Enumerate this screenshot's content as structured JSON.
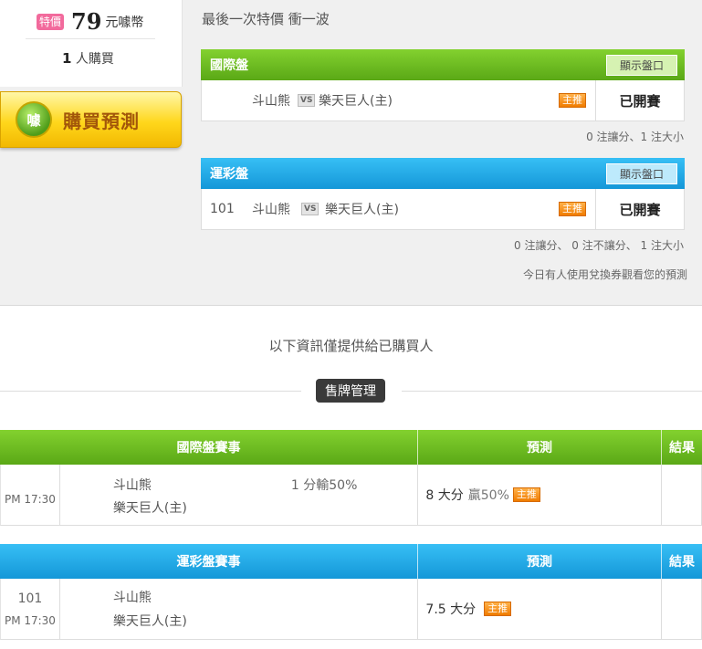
{
  "price": {
    "badge": "特價",
    "amount": "79",
    "unit": "元噱幣",
    "buyer_count": "1",
    "buyer_suffix": "人購買"
  },
  "buy_button": {
    "icon_text": "噱",
    "label": "購買預測"
  },
  "headline": "最後一次特價 衝一波",
  "cards": [
    {
      "title": "國際盤",
      "show_label": "顯示盤口",
      "match_no": "",
      "away": "斗山熊",
      "vs": "VS",
      "home": "樂天巨人(主)",
      "rec_badge": "主推",
      "status": "已開賽",
      "note": "0 注讓分、1 注大小"
    },
    {
      "title": "運彩盤",
      "show_label": "顯示盤口",
      "match_no": "101",
      "away": "斗山熊",
      "vs": "VS",
      "home": "樂天巨人(主)",
      "rec_badge": "主推",
      "status": "已開賽",
      "note": "0 注讓分、 0 注不讓分、 1 注大小"
    }
  ],
  "coupon_note": "今日有人使用兌換券觀看您的預測",
  "info_line": "以下資訊僅提供給已購買人",
  "sell_button": "售牌管理",
  "tables": [
    {
      "headers": {
        "match": "國際盤賽事",
        "prediction": "預測",
        "result": "結果"
      },
      "row": {
        "no": "",
        "time": "PM 17:30",
        "away": "斗山熊",
        "home": "樂天巨人(主)",
        "result_text": "1 分輸50%",
        "prediction": "8 大分",
        "win_text": "贏50%",
        "rec_badge": "主推"
      }
    },
    {
      "headers": {
        "match": "運彩盤賽事",
        "prediction": "預測",
        "result": "結果"
      },
      "row": {
        "no": "101",
        "time": "PM 17:30",
        "away": "斗山熊",
        "home": "樂天巨人(主)",
        "result_text": "",
        "prediction": "7.5 大分",
        "win_text": "",
        "rec_badge": "主推"
      }
    }
  ],
  "colors": {
    "green_header": "#6fbd22",
    "blue_header": "#23abe7",
    "badge_pink": "#f26a9c",
    "recommend_orange": "#f07c00",
    "buy_button_gold": "#ffd71c"
  }
}
